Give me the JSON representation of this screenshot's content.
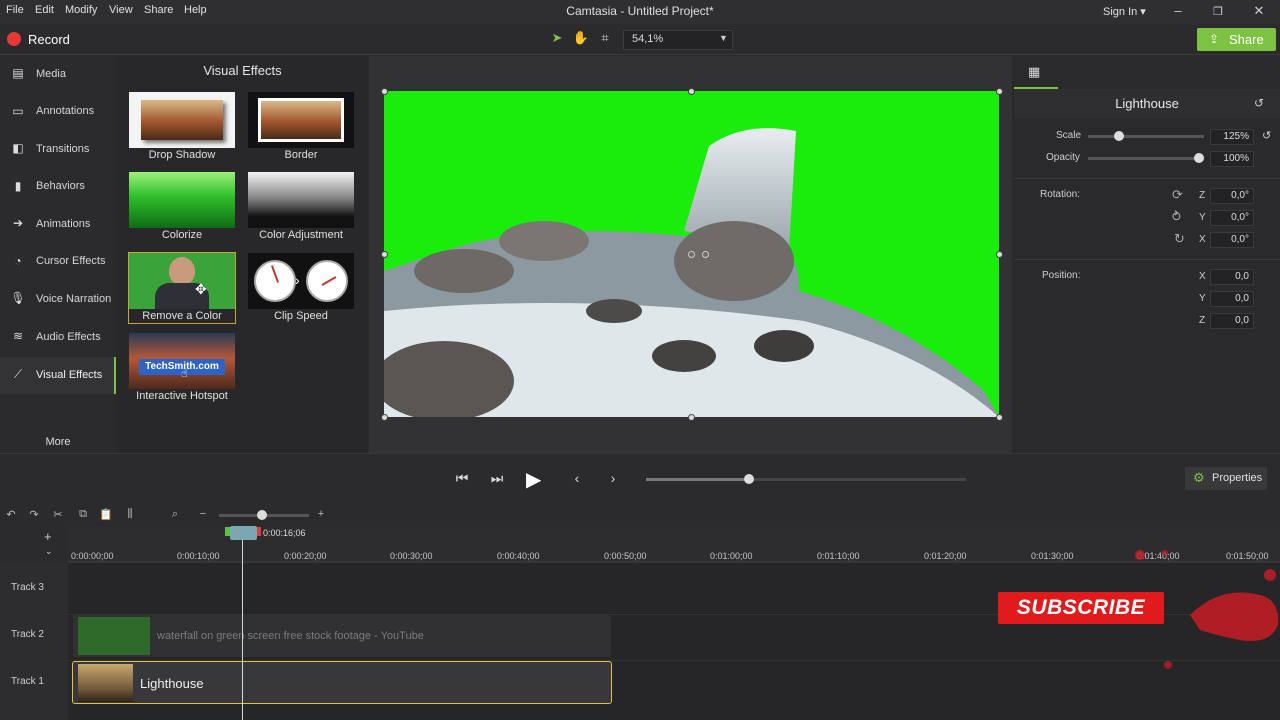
{
  "menu": {
    "file": "File",
    "edit": "Edit",
    "modify": "Modify",
    "view": "View",
    "share": "Share",
    "help": "Help"
  },
  "app_title": "Camtasia - Untitled Project*",
  "signin": "Sign In ▾",
  "toolbar": {
    "record_label": "Record",
    "zoom_value": "54,1%",
    "share_label": "Share"
  },
  "sidebar": {
    "items": [
      {
        "label": "Media",
        "icon": "media-icon"
      },
      {
        "label": "Annotations",
        "icon": "annotations-icon"
      },
      {
        "label": "Transitions",
        "icon": "transitions-icon"
      },
      {
        "label": "Behaviors",
        "icon": "behaviors-icon"
      },
      {
        "label": "Animations",
        "icon": "animations-icon"
      },
      {
        "label": "Cursor Effects",
        "icon": "cursor-effects-icon"
      },
      {
        "label": "Voice Narration",
        "icon": "microphone-icon"
      },
      {
        "label": "Audio Effects",
        "icon": "audio-effects-icon"
      },
      {
        "label": "Visual Effects",
        "icon": "magic-wand-icon"
      }
    ],
    "more_label": "More",
    "active_item": "Visual Effects"
  },
  "effects_panel": {
    "title": "Visual Effects",
    "tiles": [
      {
        "label": "Drop Shadow"
      },
      {
        "label": "Border"
      },
      {
        "label": "Colorize"
      },
      {
        "label": "Color Adjustment"
      },
      {
        "label": "Remove a Color"
      },
      {
        "label": "Clip Speed"
      },
      {
        "label": "Interactive Hotspot",
        "overlay_text": "TechSmith.com"
      }
    ]
  },
  "properties": {
    "title": "Lighthouse",
    "scale_label": "Scale",
    "scale_value": "125%",
    "scale_fraction": 0.2,
    "opacity_label": "Opacity",
    "opacity_value": "100%",
    "opacity_fraction": 1.0,
    "rotation_label": "Rotation:",
    "rotation": {
      "z": "0,0°",
      "y": "0,0°",
      "x": "0,0°"
    },
    "position_label": "Position:",
    "position": {
      "x": "0,0",
      "y": "0,0",
      "z": "0,0"
    },
    "axis": {
      "x": "X",
      "y": "Y",
      "z": "Z"
    }
  },
  "playback": {
    "properties_label": "Properties",
    "progress_fraction": 0.32
  },
  "timeline": {
    "playhead_time": "0:00:16;06",
    "ticks": [
      "0:00:00;00",
      "0:00:10;00",
      "0:00:20;00",
      "0:00:30;00",
      "0:00:40;00",
      "0:00:50;00",
      "0:01:00;00",
      "0:01:10;00",
      "0:01:20;00",
      "0:01:30;00",
      "0:01:40;00",
      "0:01:50;00"
    ],
    "tracks": [
      {
        "label": "Track 3"
      },
      {
        "label": "Track 2",
        "clip": "waterfall on green screen free stock footage - YouTube"
      },
      {
        "label": "Track 1",
        "clip": "Lighthouse"
      }
    ]
  },
  "overlay": {
    "subscribe_label": "SUBSCRIBE"
  },
  "colors": {
    "accent": "#7dc242",
    "record": "#e53935",
    "green_screen": "#1aec0c",
    "subscribe": "#e11b1b",
    "selected_clip_border": "#e0c246"
  }
}
